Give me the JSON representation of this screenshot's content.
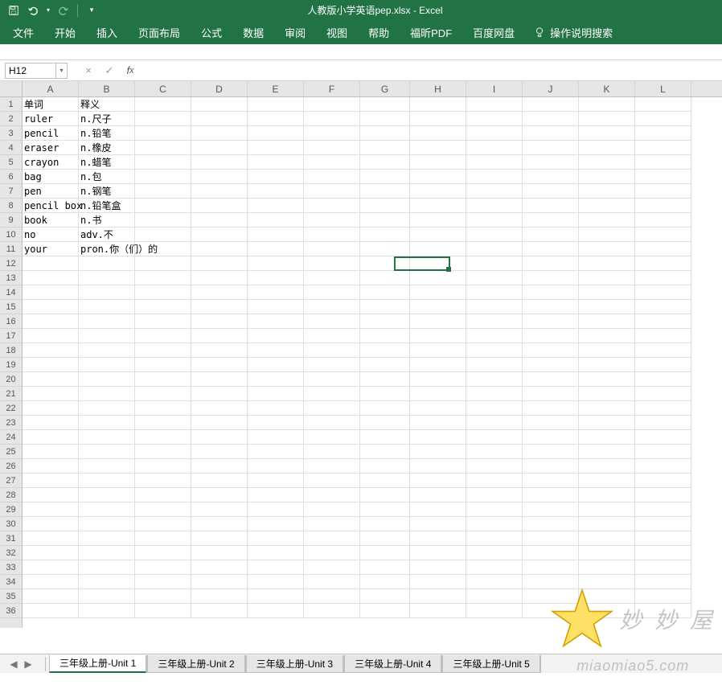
{
  "title": "人教版小学英语pep.xlsx  -  Excel",
  "qat": {
    "save": "save",
    "undo": "undo",
    "redo": "redo"
  },
  "ribbon": {
    "file": "文件",
    "home": "开始",
    "insert": "插入",
    "layout": "页面布局",
    "formulas": "公式",
    "data": "数据",
    "review": "审阅",
    "view": "视图",
    "help": "帮助",
    "foxit": "福昕PDF",
    "baidu": "百度网盘",
    "tellme": "操作说明搜索"
  },
  "formula_bar": {
    "name_box": "H12",
    "cancel": "×",
    "confirm": "✓",
    "fx": "fx",
    "input": ""
  },
  "columns": [
    "A",
    "B",
    "C",
    "D",
    "E",
    "F",
    "G",
    "H",
    "I",
    "J",
    "K",
    "L"
  ],
  "row_count": 36,
  "active_cell": {
    "col": "H",
    "row": 12
  },
  "cells": {
    "A1": "单词",
    "B1": "释义",
    "A2": "ruler",
    "B2": "n.尺子",
    "A3": "pencil",
    "B3": "n.铅笔",
    "A4": "eraser",
    "B4": "n.橡皮",
    "A5": "crayon",
    "B5": "n.蜡笔",
    "A6": "bag",
    "B6": "n.包",
    "A7": "pen",
    "B7": "n.钢笔",
    "A8": "pencil box",
    "B8": "n.铅笔盒",
    "A9": "book",
    "B9": "n.书",
    "A10": "no",
    "B10": "adv.不",
    "A11": "your",
    "B11": "pron.你（们）的"
  },
  "sheet_tabs": [
    "三年级上册-Unit 1",
    "三年级上册-Unit 2",
    "三年级上册-Unit 3",
    "三年级上册-Unit 4",
    "三年级上册-Unit 5"
  ],
  "active_sheet": 0,
  "watermark": {
    "text1": "妙 妙 屋",
    "text2": "miaomiao5.com"
  }
}
